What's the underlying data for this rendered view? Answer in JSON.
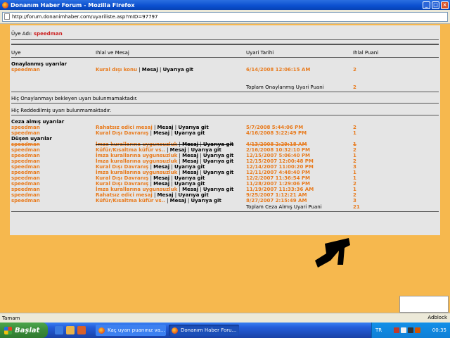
{
  "window": {
    "title": "Donanım Haber Forum - Mozilla Firefox"
  },
  "address": {
    "url": "http://forum.donanimhaber.com/uyariliste.asp?mID=97797"
  },
  "user": {
    "label": "Üye Adı:",
    "name": "speedman"
  },
  "headers": {
    "uye": "Uye",
    "ihlal": "Ihlal ve Mesaj",
    "tarih": "Uyari Tarihi",
    "puan": "Ihlal Puani"
  },
  "approved": {
    "title": "Onaylanmış uyarılar",
    "rows": [
      {
        "user": "speedman",
        "reason": "Kural dışı konu",
        "msg": "Mesaj",
        "go": "Uyarıya git",
        "date": "6/14/2008 12:06:15 AM",
        "points": "2"
      }
    ],
    "total_label": "Toplam Onaylanmış Uyari Puani",
    "total": "2"
  },
  "pending_text": "Hiç Onaylanmayı bekleyen uyarı bulunmamaktadır.",
  "rejected_text": "Hiç Reddedilmiş uyarı bulunmamaktadır.",
  "penalized": {
    "title": "Ceza almış uyarılar",
    "rows": [
      {
        "user": "speedman",
        "reason": "Rahatsız edici mesaj",
        "msg": "Mesaj",
        "go": "Uyarıya git",
        "date": "5/7/2008 5:44:06 PM",
        "points": "2"
      },
      {
        "user": "speedman",
        "reason": "Kural Dışı Davranış",
        "msg": "Mesaj",
        "go": "Uyarıya git",
        "date": "4/16/2008 3:22:49 PM",
        "points": "1"
      }
    ]
  },
  "dropped": {
    "title": "Düşen uyarılar",
    "rows": [
      {
        "user": "speedman",
        "reason": "İmza kurallarına uygunsuzluk",
        "msg": "Mesaj",
        "go": "Uyarıya git",
        "date": "4/13/2008 2:29:18 AM",
        "points": "1",
        "strike": true
      },
      {
        "user": "speedman",
        "reason": "Küfür/Kısaltma küfür vs..",
        "msg": "Mesaj",
        "go": "Uyarıya git",
        "date": "2/16/2008 10:32:10 PM",
        "points": "2"
      },
      {
        "user": "speedman",
        "reason": "İmza kurallarına uygunsuzluk",
        "msg": "Mesaj",
        "go": "Uyarıya git",
        "date": "12/15/2007 5:06:40 PM",
        "points": "1"
      },
      {
        "user": "speedman",
        "reason": "İmza kurallarına uygunsuzluk",
        "msg": "Mesaj",
        "go": "Uyarıya git",
        "date": "12/15/2007 12:00:48 PM",
        "points": "2"
      },
      {
        "user": "speedman",
        "reason": "Kural Dışı Davranış",
        "msg": "Mesaj",
        "go": "Uyarıya git",
        "date": "12/14/2007 11:00:20 PM",
        "points": "3"
      },
      {
        "user": "speedman",
        "reason": "İmza kurallarına uygunsuzluk",
        "msg": "Mesaj",
        "go": "Uyarıya git",
        "date": "12/11/2007 4:48:40 PM",
        "points": "1"
      },
      {
        "user": "speedman",
        "reason": "Kural Dışı Davranış",
        "msg": "Mesaj",
        "go": "Uyarıya git",
        "date": "12/2/2007 11:36:54 PM",
        "points": "1"
      },
      {
        "user": "speedman",
        "reason": "Kural Dışı Davranış",
        "msg": "Mesaj",
        "go": "Uyarıya git",
        "date": "11/28/2007 1:29:06 PM",
        "points": "2"
      },
      {
        "user": "speedman",
        "reason": "İmza kurallarına uygunsuzluk",
        "msg": "Mesaj",
        "go": "Uyarıya git",
        "date": "11/19/2007 11:33:36 AM",
        "points": "1"
      },
      {
        "user": "speedman",
        "reason": "Rahatsız edici mesaj",
        "msg": "Mesaj",
        "go": "Uyarıya git",
        "date": "9/25/2007 1:12:21 AM",
        "points": "2"
      },
      {
        "user": "speedman",
        "reason": "Küfür/Kısaltma küfür vs..",
        "msg": "Mesaj",
        "go": "Uyarıya git",
        "date": "8/27/2007 2:15:49 AM",
        "points": "3"
      }
    ],
    "total_label": "Toplam Ceza Almış Uyari Puani",
    "total": "21"
  },
  "status": {
    "text": "Tamam",
    "adblock": "Adblock"
  },
  "taskbar": {
    "start": "Başlat",
    "tasks": [
      "Kaç uyarı puanınız va...",
      "Donanım Haber Foru..."
    ],
    "lang": "TR",
    "clock": "00:35"
  },
  "colors": {
    "accent": "#e87a1c",
    "username": "#cc2222",
    "background": "#f6b84e",
    "panel": "#e5e5e5"
  }
}
